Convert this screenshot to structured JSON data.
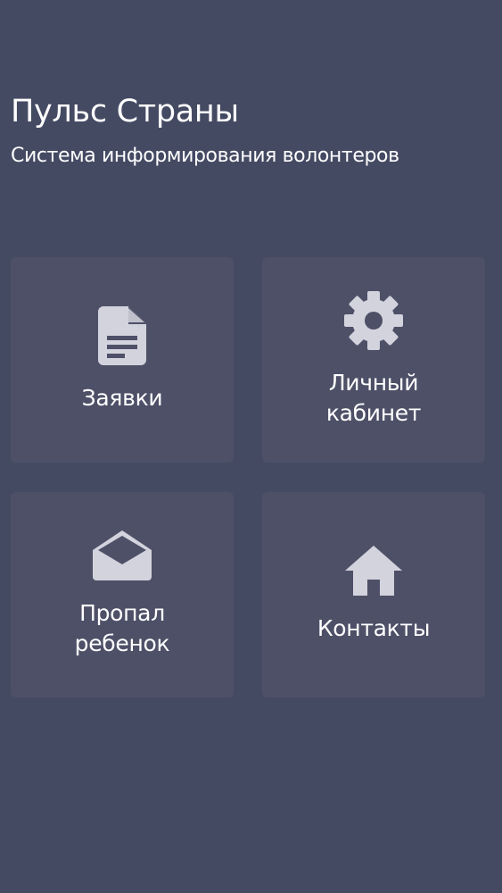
{
  "header": {
    "title": "Пульс Страны",
    "subtitle": "Система информирования волонтеров"
  },
  "colors": {
    "background": "#454a63",
    "tile": "#4e5068",
    "icon": "#d3d3dd",
    "text": "#ffffff"
  },
  "tiles": [
    {
      "label": "Заявки",
      "icon": "document-icon"
    },
    {
      "label": "Личный\nкабинет",
      "icon": "gear-icon"
    },
    {
      "label": "Пропал\nребенок",
      "icon": "open-envelope-icon"
    },
    {
      "label": "Контакты",
      "icon": "home-icon"
    }
  ]
}
